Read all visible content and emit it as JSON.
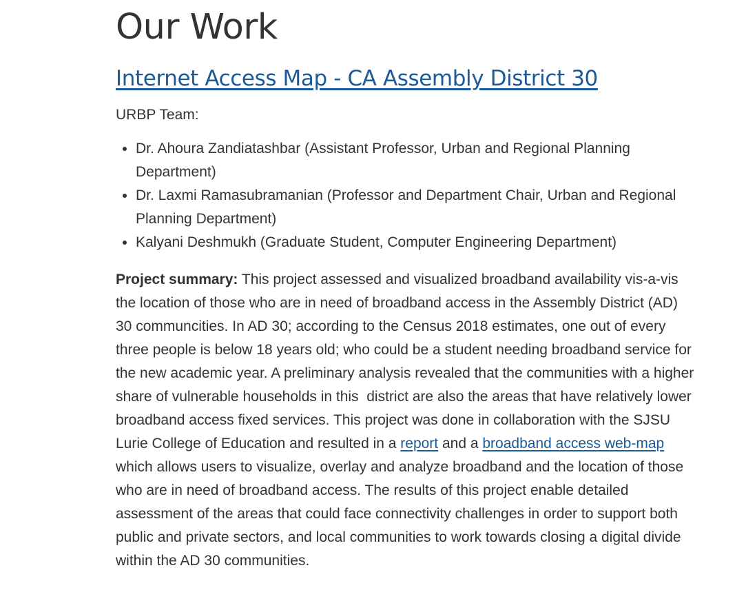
{
  "page": {
    "title": "Our Work"
  },
  "project": {
    "title": "Internet Access Map - CA Assembly District 30",
    "team_label": "URBP Team:",
    "team": [
      "Dr. Ahoura Zandiatashbar (Assistant Professor, Urban and Regional Planning Department)",
      "Dr. Laxmi Ramasubramanian (Professor and Department Chair, Urban and Regional Planning Department)",
      "Kalyani Deshmukh (Graduate Student, Computer Engineering Department)"
    ],
    "summary": {
      "label": "Project summary:",
      "text_1": " This project assessed and visualized broadband availability vis-a-vis the location of those who are in need of broadband access in the Assembly District (AD) 30 communcities. In AD 30; according to the Census 2018 estimates, one out of every three people is below 18 years old; who could be a student needing broadband service for the new academic year. A preliminary analysis revealed that the communities with a higher share of vulnerable households in this  district are also the areas that have relatively lower broadband access fixed services. This project was done in collaboration with the SJSU Lurie College of Education and resulted in a ",
      "link_report": "report",
      "text_2": " and a ",
      "link_webmap": "broadband access web-map",
      "text_3": " which allows users to visualize, overlay and analyze broadband and the location of those who are in need of broadband access. The results of this project enable detailed assessment of the areas that could face connectivity challenges in order to support both public and private sectors, and local communities to work towards closing a digital divide within the AD 30 communities."
    }
  },
  "colors": {
    "text": "#333333",
    "link": "#1a5a99",
    "background": "#ffffff"
  }
}
